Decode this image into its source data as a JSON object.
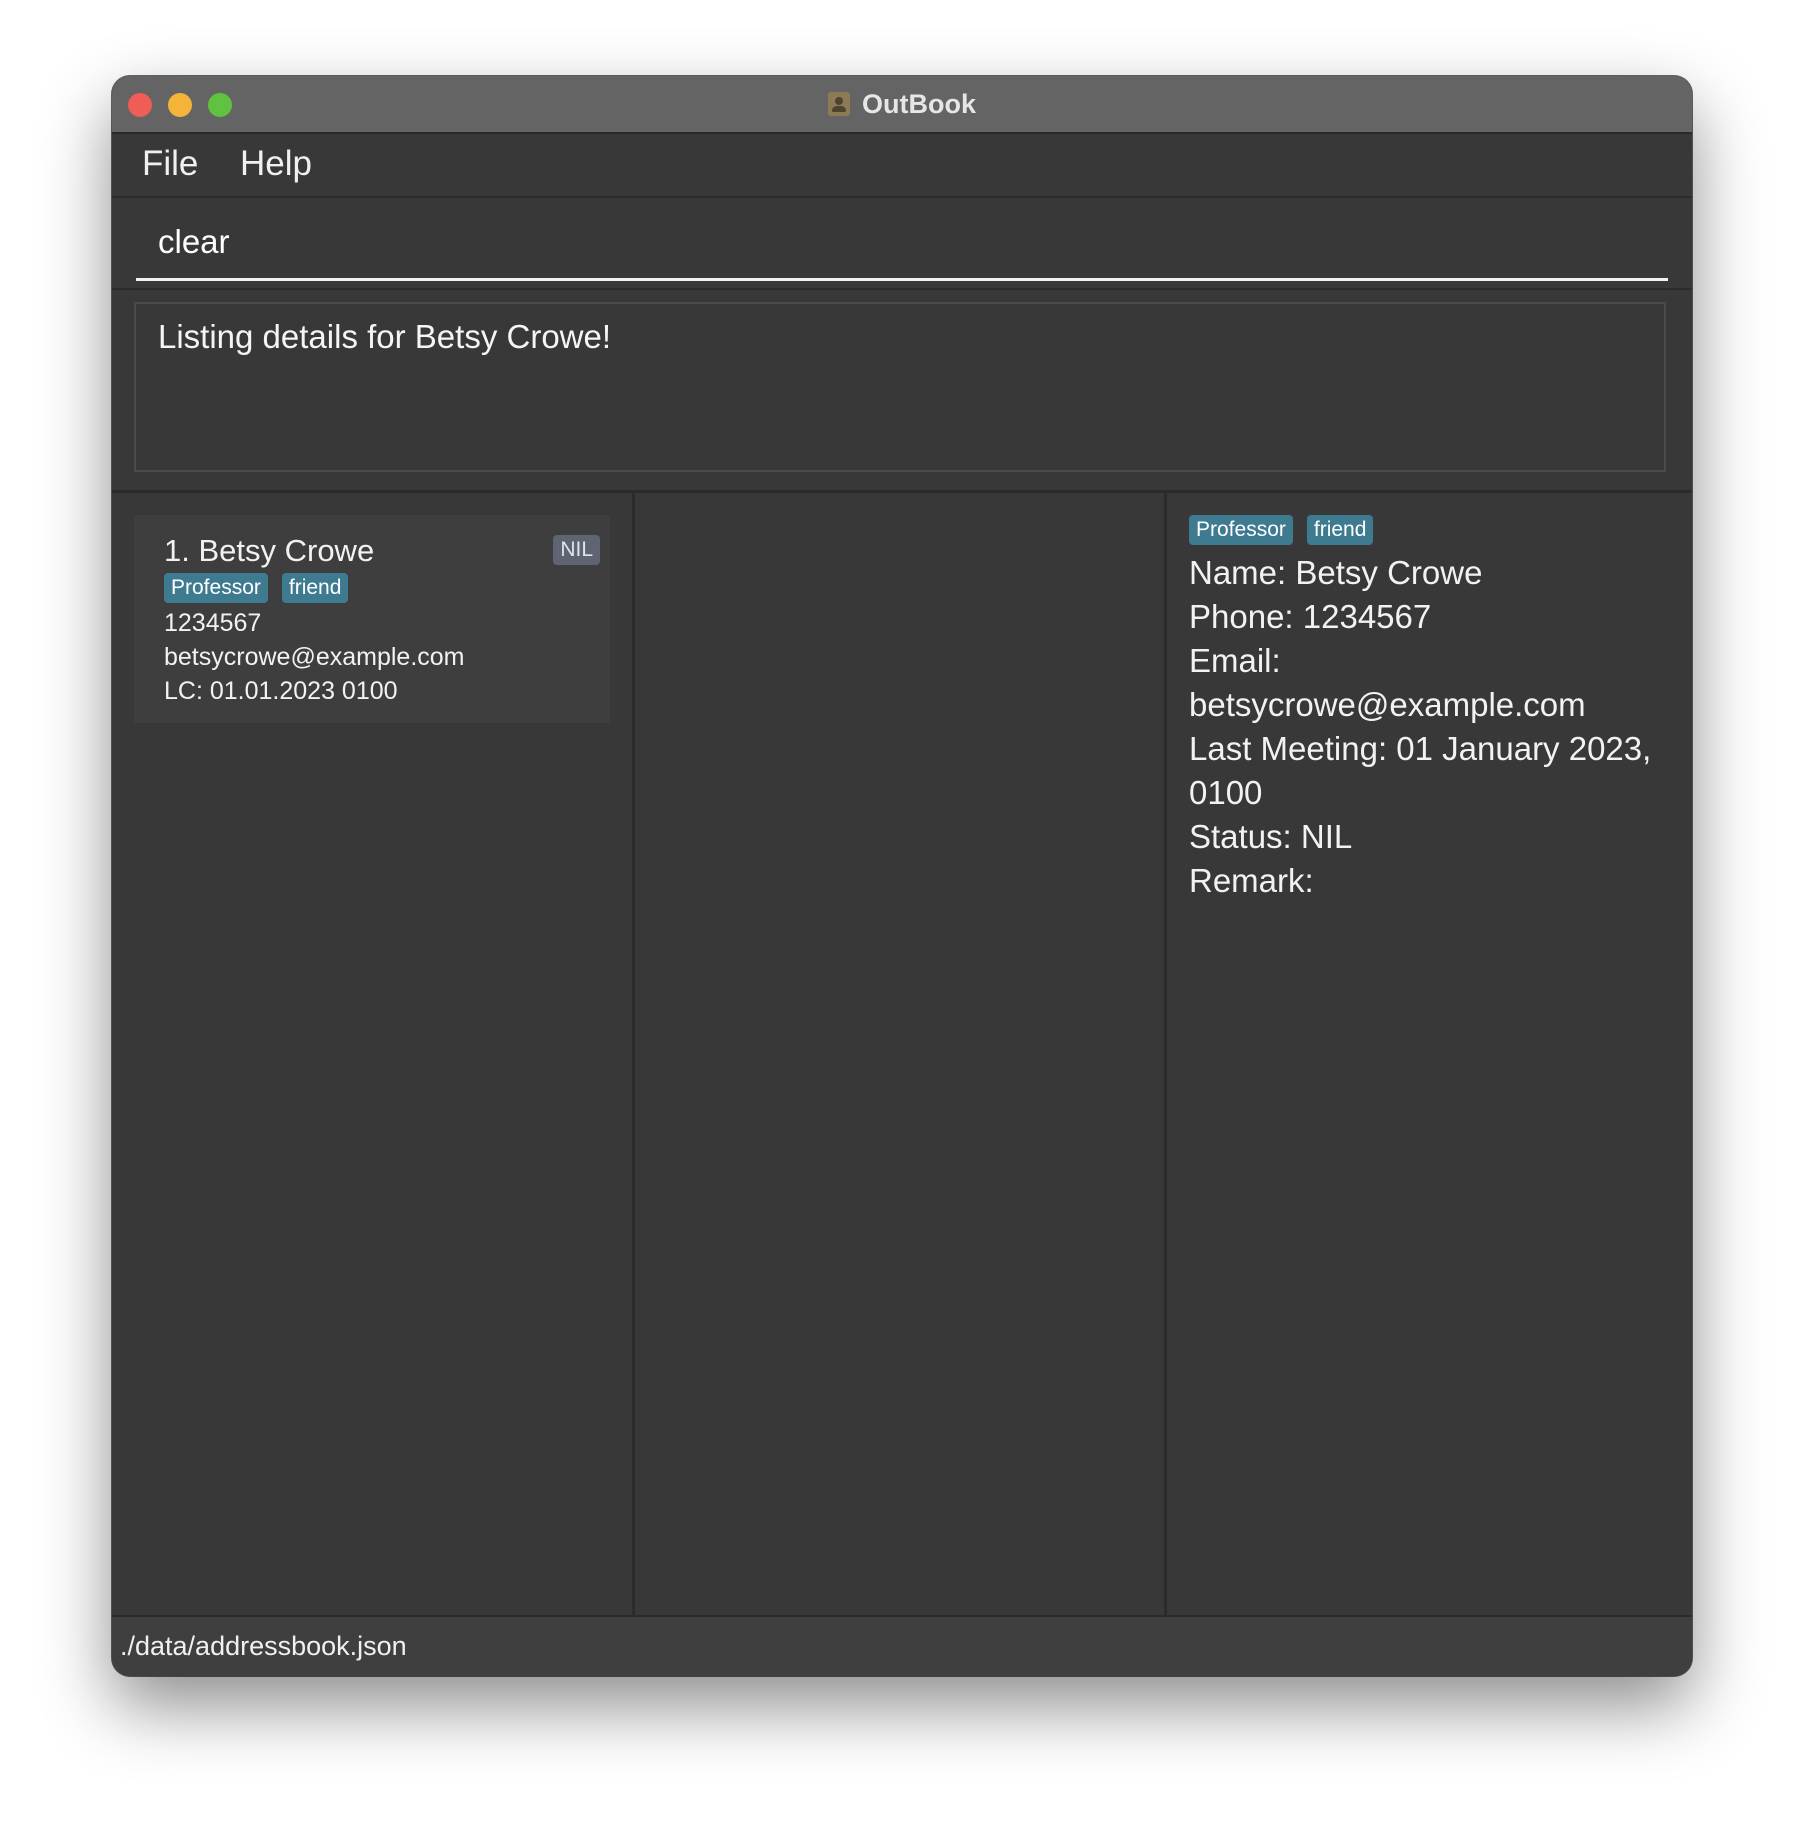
{
  "window": {
    "title": "OutBook"
  },
  "menu": {
    "file": "File",
    "help": "Help"
  },
  "command": {
    "value": "clear"
  },
  "result": {
    "message": "Listing details for Betsy Crowe!"
  },
  "person_list": [
    {
      "index_name": "1.  Betsy Crowe",
      "status": "NIL",
      "tags": [
        "Professor",
        "friend"
      ],
      "phone": "1234567",
      "email": "betsycrowe@example.com",
      "last_contact": "LC: 01.01.2023 0100"
    }
  ],
  "detail": {
    "tags": [
      "Professor",
      "friend"
    ],
    "name": "Name: Betsy Crowe",
    "phone": "Phone: 1234567",
    "email_label": "Email:",
    "email": "betsycrowe@example.com",
    "last_meeting": "Last Meeting: 01 January 2023, 0100",
    "status": "Status: NIL",
    "remark": "Remark:"
  },
  "status_bar": {
    "path": "./data/addressbook.json"
  },
  "colors": {
    "window_bg": "#383838",
    "titlebar_bg": "#646464",
    "tag_bg": "#3e7b91",
    "status_chip_bg": "#5f6472",
    "close": "#ee5e56",
    "minimize": "#f4b43a",
    "maximize": "#5fc240"
  }
}
